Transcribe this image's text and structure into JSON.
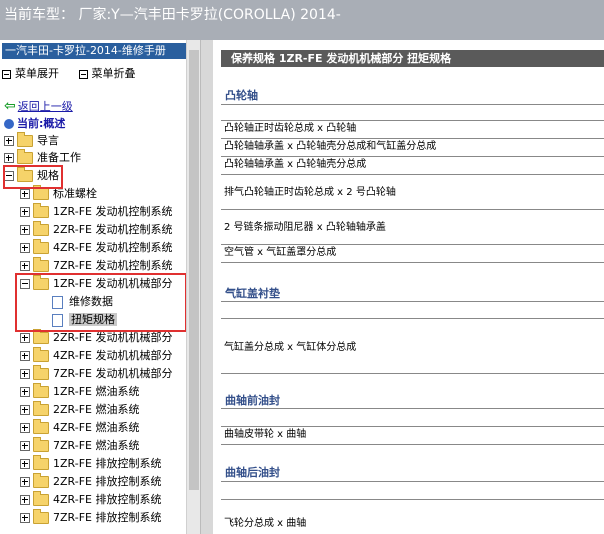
{
  "window": {
    "title": "当前车型：   厂家:Y—汽丰田卡罗拉(COROLLA) 2014-"
  },
  "sidebar": {
    "header": "一汽丰田-卡罗拉-2014-维修手册",
    "expand_all": "菜单展开",
    "collapse_all": "菜单折叠",
    "back_label": "返回上一级",
    "current_label": "当前:概述",
    "tree": [
      {
        "label": "导言",
        "indent": 0,
        "type": "folder"
      },
      {
        "label": "准备工作",
        "indent": 0,
        "type": "folder"
      },
      {
        "label": "规格",
        "indent": 0,
        "type": "folder"
      },
      {
        "label": "标准螺栓",
        "indent": 1,
        "type": "folder"
      },
      {
        "label": "1ZR-FE 发动机控制系统",
        "indent": 1,
        "type": "folder"
      },
      {
        "label": "2ZR-FE 发动机控制系统",
        "indent": 1,
        "type": "folder"
      },
      {
        "label": "4ZR-FE 发动机控制系统",
        "indent": 1,
        "type": "folder"
      },
      {
        "label": "7ZR-FE 发动机控制系统",
        "indent": 1,
        "type": "folder"
      },
      {
        "label": "1ZR-FE 发动机机械部分",
        "indent": 1,
        "type": "folder"
      },
      {
        "label": "维修数据",
        "indent": 2,
        "type": "doc"
      },
      {
        "label": "扭矩规格",
        "indent": 2,
        "type": "doc"
      },
      {
        "label": "2ZR-FE 发动机机械部分",
        "indent": 1,
        "type": "folder"
      },
      {
        "label": "4ZR-FE 发动机机械部分",
        "indent": 1,
        "type": "folder"
      },
      {
        "label": "7ZR-FE 发动机机械部分",
        "indent": 1,
        "type": "folder"
      },
      {
        "label": "1ZR-FE 燃油系统",
        "indent": 1,
        "type": "folder"
      },
      {
        "label": "2ZR-FE 燃油系统",
        "indent": 1,
        "type": "folder"
      },
      {
        "label": "4ZR-FE 燃油系统",
        "indent": 1,
        "type": "folder"
      },
      {
        "label": "7ZR-FE 燃油系统",
        "indent": 1,
        "type": "folder"
      },
      {
        "label": "1ZR-FE 排放控制系统",
        "indent": 1,
        "type": "folder"
      },
      {
        "label": "2ZR-FE 排放控制系统",
        "indent": 1,
        "type": "folder"
      },
      {
        "label": "4ZR-FE 排放控制系统",
        "indent": 1,
        "type": "folder"
      },
      {
        "label": "7ZR-FE 排放控制系统",
        "indent": 1,
        "type": "folder"
      }
    ]
  },
  "content": {
    "header": "保养规格  1ZR-FE 发动机机械部分  扭矩规格",
    "sections": [
      {
        "title": "凸轮轴",
        "rows": [
          "",
          "凸轮轴正时齿轮总成 x 凸轮轴",
          "凸轮轴轴承盖 x 凸轮轴壳分总成和气缸盖分总成",
          "凸轮轴轴承盖 x 凸轮轴壳分总成",
          "排气凸轮轴正时齿轮总成 x 2 号凸轮轴",
          "2 号链条振动阻尼器 x 凸轮轴轴承盖",
          "空气管 x 气缸盖罩分总成"
        ]
      },
      {
        "title": "气缸盖衬垫",
        "rows": [
          "",
          "气缸盖分总成 x 气缸体分总成"
        ]
      },
      {
        "title": "曲轴前油封",
        "rows": [
          "",
          "曲轴皮带轮 x 曲轴"
        ]
      },
      {
        "title": "曲轴后油封",
        "rows": [
          "",
          "飞轮分总成 x 曲轴"
        ]
      }
    ]
  },
  "colors": {
    "sidebar_header": "#2a5f9e",
    "highlight_box": "#e03030",
    "section_title": "#334f8a",
    "doc_header": "#5a5a5a"
  }
}
